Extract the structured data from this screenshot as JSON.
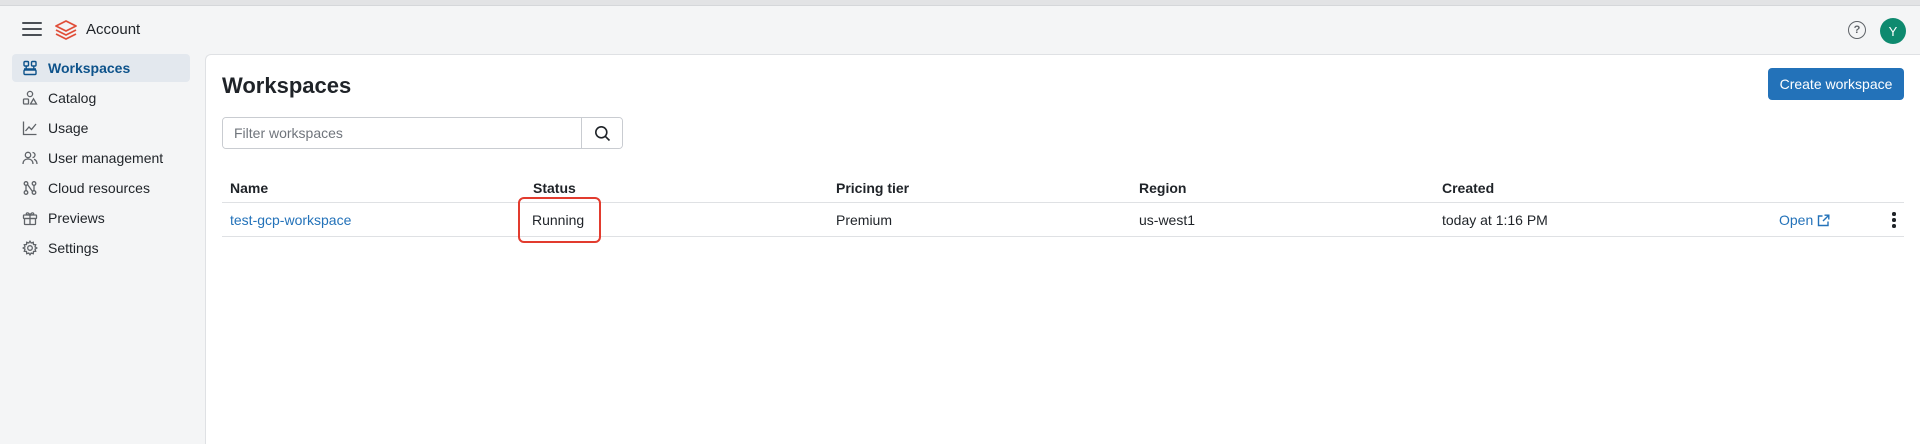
{
  "header": {
    "app_title": "Account",
    "help_symbol": "?",
    "avatar_initial": "Y",
    "icons": [
      "hamburger-menu-icon",
      "databricks-logo-icon",
      "help-icon"
    ]
  },
  "sidebar": {
    "items": [
      {
        "label": "Workspaces",
        "icon": "workspaces-icon",
        "active": true
      },
      {
        "label": "Catalog",
        "icon": "catalog-icon",
        "active": false
      },
      {
        "label": "Usage",
        "icon": "usage-chart-icon",
        "active": false
      },
      {
        "label": "User management",
        "icon": "users-icon",
        "active": false
      },
      {
        "label": "Cloud resources",
        "icon": "cloud-resources-icon",
        "active": false
      },
      {
        "label": "Previews",
        "icon": "gift-icon",
        "active": false
      },
      {
        "label": "Settings",
        "icon": "gear-icon",
        "active": false
      }
    ]
  },
  "main": {
    "title": "Workspaces",
    "create_button": "Create workspace",
    "search": {
      "placeholder": "Filter workspaces",
      "value": ""
    },
    "table": {
      "columns": [
        "Name",
        "Status",
        "Pricing tier",
        "Region",
        "Created"
      ],
      "rows": [
        {
          "name": "test-gcp-workspace",
          "status": "Running",
          "pricing_tier": "Premium",
          "region": "us-west1",
          "created": "today at 1:16 PM",
          "open_label": "Open"
        }
      ]
    }
  },
  "colors": {
    "accent": "#2372b9",
    "active_nav_text": "#0e538b",
    "active_nav_bg": "#e3e8ee",
    "avatar_bg": "#0e8a6f",
    "highlight_box": "#e23b2e",
    "logo": "#e04e39"
  }
}
